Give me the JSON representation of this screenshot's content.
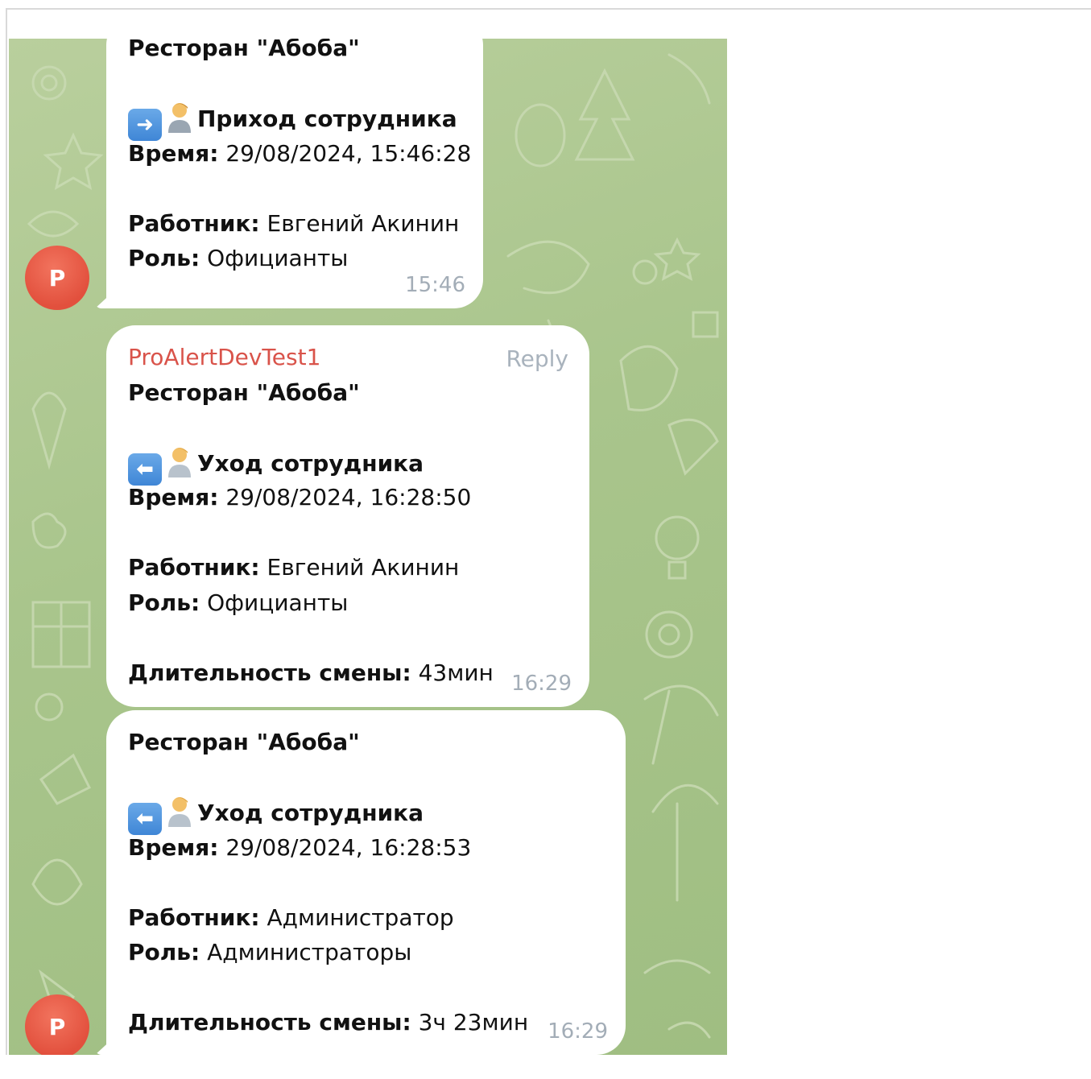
{
  "messages": [
    {
      "restaurant": "Ресторан \"Абоба\"",
      "event_icon": "arrow-right-icon",
      "event_title": "Приход сотрудника",
      "time_label": "Время:",
      "time_value": "29/08/2024, 15:46:28",
      "worker_label": "Работник:",
      "worker_value": "Евгений Акинин",
      "role_label": "Роль:",
      "role_value": "Официанты",
      "timestamp": "15:46",
      "avatar_letter": "P"
    },
    {
      "sender": "ProAlertDevTest1",
      "reply_label": "Reply",
      "restaurant": "Ресторан \"Абоба\"",
      "event_icon": "arrow-left-icon",
      "event_title": "Уход сотрудника",
      "time_label": "Время:",
      "time_value": "29/08/2024, 16:28:50",
      "worker_label": "Работник:",
      "worker_value": "Евгений Акинин",
      "role_label": "Роль:",
      "role_value": "Официанты",
      "duration_label": "Длительность смены:",
      "duration_value": "43мин",
      "timestamp": "16:29"
    },
    {
      "restaurant": "Ресторан \"Абоба\"",
      "event_icon": "arrow-left-icon",
      "event_title": "Уход сотрудника",
      "time_label": "Время:",
      "time_value": "29/08/2024, 16:28:53",
      "worker_label": "Работник:",
      "worker_value": "Администратор",
      "role_label": "Роль:",
      "role_value": "Администраторы",
      "duration_label": "Длительность смены:",
      "duration_value": "3ч 23мин",
      "timestamp": "16:29",
      "avatar_letter": "P"
    }
  ],
  "colors": {
    "sender": "#d9534a",
    "avatar": "#e2503d",
    "chat_background": "#a9c58c"
  }
}
